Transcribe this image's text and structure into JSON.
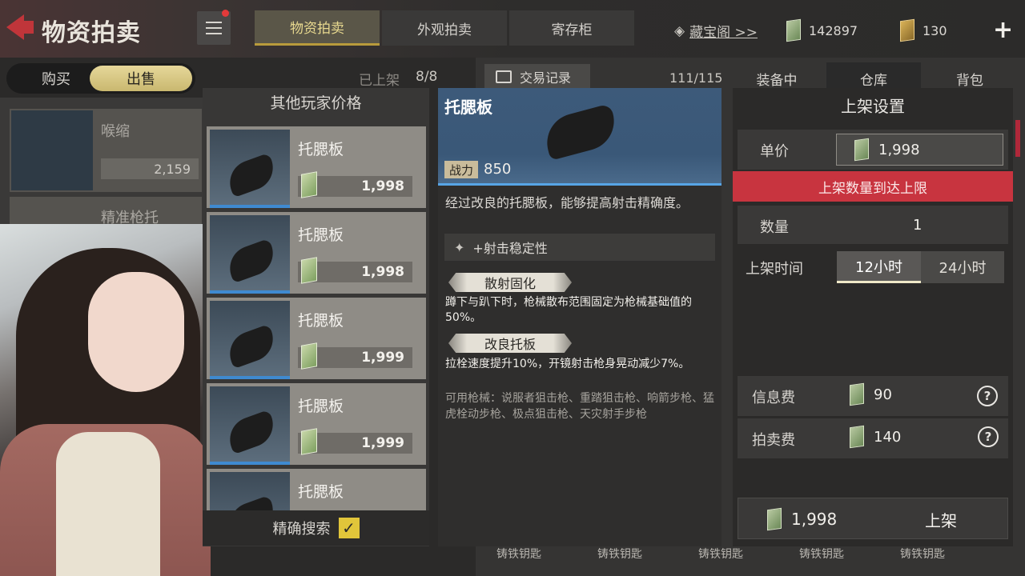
{
  "header": {
    "title": "物资拍卖",
    "tabs": [
      {
        "label": "物资拍卖",
        "active": true
      },
      {
        "label": "外观拍卖",
        "active": false
      },
      {
        "label": "寄存柜",
        "active": false
      }
    ],
    "vault_link": "藏宝阁 >>",
    "currency_cash": "142897",
    "currency_gold": "130",
    "add_label": "+"
  },
  "trade_mode": {
    "buy_label": "购买",
    "sell_label": "出售",
    "listed_label": "已上架",
    "listed_count": "8/8"
  },
  "bg_items": [
    {
      "name": "喉缩",
      "price": "2,159"
    },
    {
      "name": "精准枪托"
    }
  ],
  "others_panel": {
    "title": "其他玩家价格",
    "listings": [
      {
        "name": "托腮板",
        "price": "1,998"
      },
      {
        "name": "托腮板",
        "price": "1,998"
      },
      {
        "name": "托腮板",
        "price": "1,999"
      },
      {
        "name": "托腮板",
        "price": "1,999"
      },
      {
        "name": "托腮板"
      }
    ],
    "precise_search_label": "精确搜索",
    "precise_search_checked": true
  },
  "detail": {
    "name": "托腮板",
    "power_label": "战力",
    "power_value": "850",
    "description": "经过改良的托腮板，能够提高射击精确度。",
    "stat": "+射击稳定性",
    "perks": [
      {
        "name": "散射固化",
        "desc": "蹲下与趴下时，枪械散布范围固定为枪械基础值的50%。"
      },
      {
        "name": "改良托板",
        "desc": "拉栓速度提升10%，开镜射击枪身晃动减少7%。"
      }
    ],
    "compatible": "可用枪械：说服者狙击枪、重踏狙击枪、响箭步枪、猛虎栓动步枪、极点狙击枪、天灾射手步枪"
  },
  "inventory": {
    "trade_record_label": "交易记录",
    "capacity": "111/115",
    "tabs": [
      {
        "label": "装备中",
        "active": false
      },
      {
        "label": "仓库",
        "active": true
      },
      {
        "label": "背包",
        "active": false
      }
    ],
    "bottom_items": [
      "铸铁钥匙",
      "铸铁钥匙",
      "铸铁钥匙",
      "铸铁钥匙",
      "铸铁钥匙"
    ]
  },
  "listing_settings": {
    "title": "上架设置",
    "unit_price_label": "单价",
    "unit_price": "1,998",
    "limit_warning": "上架数量到达上限",
    "quantity_label": "数量",
    "quantity": "1",
    "duration_label": "上架时间",
    "duration_options": [
      {
        "label": "12小时",
        "selected": true
      },
      {
        "label": "24小时",
        "selected": false
      }
    ],
    "info_fee_label": "信息费",
    "info_fee": "90",
    "auction_fee_label": "拍卖费",
    "auction_fee": "140",
    "help_label": "?",
    "total": "1,998",
    "submit_label": "上架"
  },
  "colors": {
    "accent_gold": "#e1c53a",
    "warning_red": "#c8343f",
    "detail_blue": "#3d5a7a",
    "rarity_blue": "#3f8ad0"
  }
}
